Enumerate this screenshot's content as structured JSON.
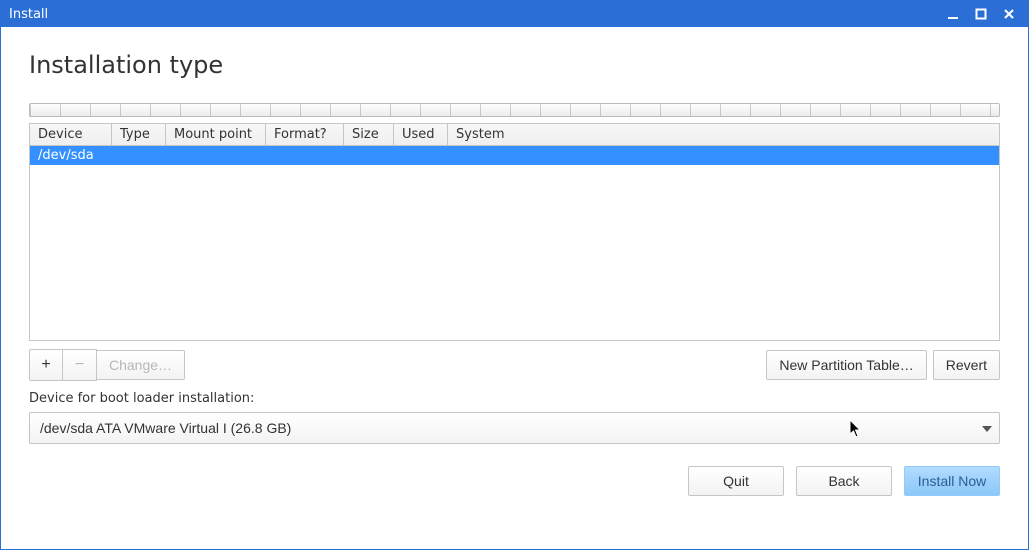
{
  "window": {
    "title": "Install"
  },
  "page": {
    "heading": "Installation type"
  },
  "table": {
    "columns": [
      "Device",
      "Type",
      "Mount point",
      "Format?",
      "Size",
      "Used",
      "System"
    ],
    "rows": [
      {
        "device": "/dev/sda",
        "type": "",
        "mount": "",
        "format": "",
        "size": "",
        "used": "",
        "system": ""
      }
    ]
  },
  "buttons": {
    "add": "+",
    "remove": "−",
    "change": "Change…",
    "new_partition_table": "New Partition Table…",
    "revert": "Revert",
    "quit": "Quit",
    "back": "Back",
    "install_now": "Install Now"
  },
  "bootloader": {
    "label": "Device for boot loader installation:",
    "selected": "/dev/sda  ATA VMware Virtual I (26.8 GB)"
  }
}
